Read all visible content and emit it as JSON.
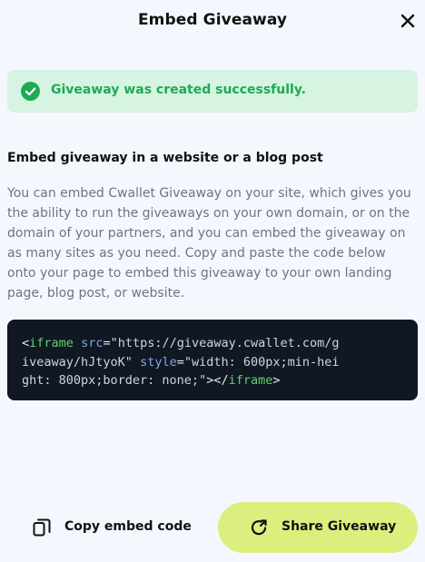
{
  "header": {
    "title": "Embed Giveaway"
  },
  "success": {
    "message": "Giveaway was created successfully.",
    "color": "#1eaa55",
    "background": "#d6f4e1"
  },
  "embed": {
    "heading": "Embed giveaway in a website or a blog post",
    "description": "You can embed Cwallet Giveaway on your site, which gives you the ability to run the giveaways on your own domain, or on the domain of your partners, and you can embed the giveaway on as many sites as you need. Copy and paste the code below onto your page to embed this giveaway to your own landing page, blog post, or website.",
    "code": {
      "line1": {
        "open": "<",
        "tag": "iframe",
        "sp1": " ",
        "attr_src": "src",
        "eq1": "=",
        "src_start": "\"https://giveaway.cwallet.com/g"
      },
      "line2": {
        "src_end": "iveaway/hJtyoK\"",
        "sp2": " ",
        "attr_style": "style",
        "eq2": "=",
        "style_start": "\"width: 600px;min-hei"
      },
      "line3": {
        "style_end": "ght: 800px;border: none;\"",
        "close": "></",
        "tag": "iframe",
        "end": ">"
      }
    }
  },
  "actions": {
    "copy_label": "Copy embed code",
    "share_label": "Share Giveaway",
    "accent": "#dcef7e"
  },
  "icons": {
    "close": "close-icon",
    "success": "check-circle-icon",
    "copy": "copy-icon",
    "share": "share-icon"
  }
}
